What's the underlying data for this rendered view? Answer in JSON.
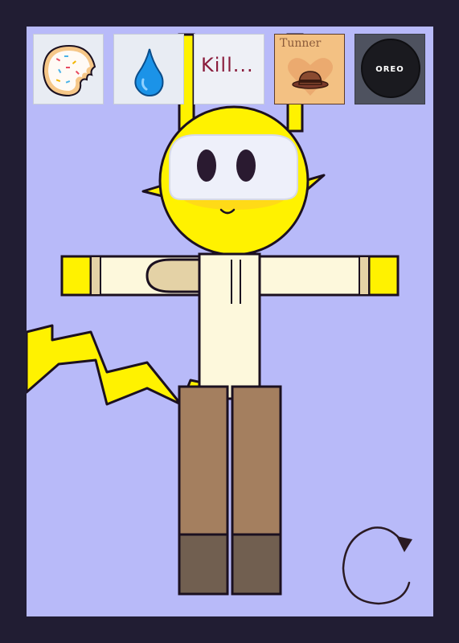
{
  "game": {
    "items": [
      {
        "label": "",
        "icon": "frosted-cookie-icon"
      },
      {
        "label": "",
        "icon": "water-drop-icon"
      },
      {
        "label": "Kill...",
        "icon": "kill-note-icon"
      },
      {
        "label": "Tunner",
        "icon": "hat-card-icon"
      },
      {
        "label": "OREO",
        "icon": "oreo-icon"
      }
    ],
    "rotate_icon": "rotate-arrow-icon"
  },
  "colors": {
    "frame": "#211d33",
    "background": "#b8baf9",
    "character_yellow": "#fff200",
    "shirt": "#fdf8dc",
    "pants": "#a47f5f",
    "boots": "#715f50"
  }
}
